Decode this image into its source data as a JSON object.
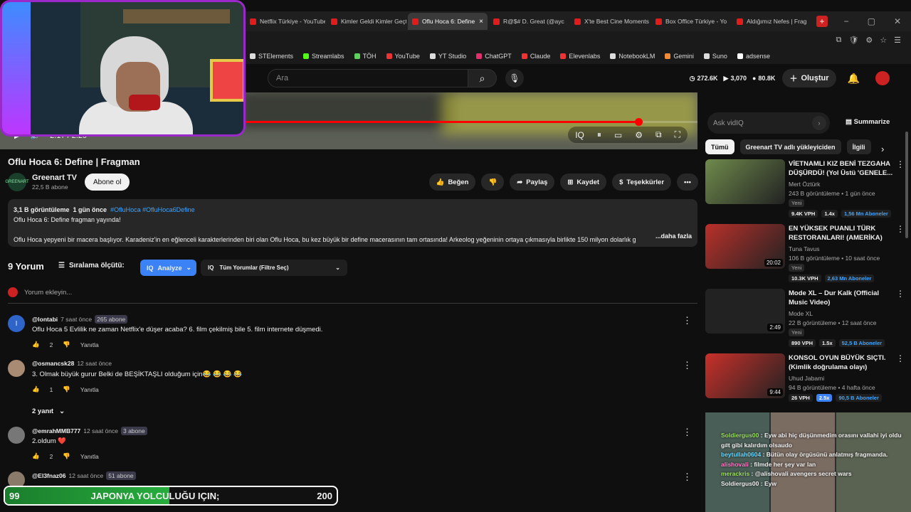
{
  "browser": {
    "tabs": [
      {
        "label": "Netflix Türkiye - YouTube",
        "active": false
      },
      {
        "label": "Kimler Geldi Kimler Geçti",
        "active": false
      },
      {
        "label": "Oflu Hoca 6: Define",
        "active": true
      },
      {
        "label": "R@$# D. Great (@ayc",
        "active": false
      },
      {
        "label": "X'te Best Cine Moments",
        "active": false
      },
      {
        "label": "Box Office Türkiye - Yo",
        "active": false
      },
      {
        "label": "Aldığımız Nefes | Frag",
        "active": false
      }
    ],
    "bookmarks": [
      "STElements",
      "Streamlabs",
      "TÖH",
      "YouTube",
      "YT Studio",
      "ChatGPT",
      "Claude",
      "Elevenlabs",
      "NotebookLM",
      "Gemini",
      "Suno",
      "adsense"
    ]
  },
  "header": {
    "search_placeholder": "Ara",
    "stats": [
      "272.6K",
      "3,070",
      "80.8K"
    ],
    "create_label": "Oluştur"
  },
  "player": {
    "time": "2:17 / 2:29",
    "progress": 0.915
  },
  "video": {
    "title": "Oflu Hoca 6: Define | Fragman",
    "channel_name": "Greenart TV",
    "channel_subs": "22,5 B abone",
    "channel_avatar_text": "GREENART",
    "subscribe_label": "Abone ol",
    "actions": {
      "like": "Beğen",
      "share": "Paylaş",
      "save": "Kaydet",
      "thanks": "Teşekkürler"
    }
  },
  "description": {
    "views": "3,1 B görüntüleme",
    "date": "1 gün önce",
    "tags": "#OfluHoca #OfluHoca6Define",
    "line1": "Oflu Hoca 6: Define fragman yayında!",
    "line2": "Oflu Hoca yepyeni bir macera başlıyor. Karadeniz'in en eğlenceli karakterlerinden biri olan Oflu Hoca, bu kez büyük bir define macerasının tam ortasında! Arkeolog yeğeninin ortaya çıkmasıyla birlikte 150 milyon dolarlık g",
    "more": "...daha fazla"
  },
  "comments_header": {
    "count": "9 Yorum",
    "sort_label": "Sıralama ölçütü:",
    "analyze_label": "Analyze",
    "filter_label": "Tüm Yorumlar (Filtre Seç)",
    "add_placeholder": "Yorum ekleyin..."
  },
  "comments": [
    {
      "user": "@lontabi",
      "time": "7 saat önce",
      "badge": "265 abone",
      "text": "Oflu Hoca 5 Evlilik ne zaman Netflix'e düşer acaba? 6. film çekilmiş bile 5. film internete düşmedi.",
      "likes": "2",
      "reply": "Yanıtla",
      "avatar": "I",
      "color": "#2f64c8"
    },
    {
      "user": "@osmancsk28",
      "time": "12 saat önce",
      "badge": "",
      "text": "3. Olmak büyük gurur Belki de BEŞİKTAŞLI olduğum için😂 😂 😂 😂",
      "likes": "1",
      "reply": "Yanıtla",
      "avatar": "",
      "color": "#a98b74"
    },
    {
      "user": "@emrahMMB777",
      "time": "12 saat önce",
      "badge": "3 abone",
      "text": "2.oldum ❤️",
      "likes": "2",
      "reply": "Yanıtla",
      "avatar": "",
      "color": "#777"
    },
    {
      "user": "@El3fnaz06",
      "time": "12 saat önce",
      "badge": "51 abone",
      "text": "",
      "likes": "",
      "reply": "",
      "avatar": "",
      "color": "#8a7a6a"
    }
  ],
  "replies_toggle": "2 yanıt",
  "sidebar": {
    "vidiq_placeholder": "Ask vidIQ",
    "summarize_label": "Summarize",
    "chips": [
      "Tümü",
      "Greenart TV adlı yükleyiciden",
      "İlgili"
    ],
    "recs": [
      {
        "title": "VİETNAMLI KIZ BENİ TEZGAHA DÜŞÜRDÜ! (Yol Üstü 'GENELE...",
        "channel": "Mert Öztürk",
        "views": "243 B görüntüleme • 1 gün önce",
        "new": "Yeni",
        "vph": "9.4K VPH",
        "mult": "1.4x",
        "subs": "1,56 Mn Aboneler",
        "duration": "",
        "color": "#6f8a4c"
      },
      {
        "title": "EN YÜKSEK PUANLI TÜRK RESTORANLARI! (AMERİKA)",
        "channel": "Tuna Tavus",
        "views": "106 B görüntüleme • 10 saat önce",
        "new": "Yeni",
        "vph": "10.3K VPH",
        "mult": "",
        "subs": "2,63 Mn Aboneler",
        "duration": "20:02",
        "color": "#b9302a"
      },
      {
        "title": "Mode XL – Dur Kalk (Official Music Video)",
        "channel": "Mode XL",
        "views": "22 B görüntüleme • 12 saat önce",
        "new": "Yeni",
        "vph": "890 VPH",
        "mult": "1.5x",
        "subs": "52,5 B Aboneler",
        "duration": "2:49",
        "color": "#222"
      },
      {
        "title": "KONSOL OYUN BÜYÜK SIÇTI. (Kimlik doğrulama olayı)",
        "channel": "Uhud Jabami",
        "views": "94 B görüntüleme • 4 hafta önce",
        "new": "",
        "vph": "26 VPH",
        "mult": "2.5x",
        "subs": "90,5 B Aboneler",
        "duration": "9:44",
        "color": "#c9302a"
      }
    ]
  },
  "chat": [
    {
      "user": "Soldiergus00",
      "msg": "Eyw abi hiç düşünmedim orasını vallahi iyi oldu g#t gibi kalırdım olsaudo"
    },
    {
      "user": "beytullah0604",
      "msg": "Bütün olay örgüsünü anlatmış fragmanda."
    },
    {
      "user": "alishovali",
      "msg": "filmde her şey var lan"
    },
    {
      "user": "merackris",
      "msg": "@alishovali avengers secret wars"
    },
    {
      "user": "Soldiergus00",
      "msg": "Eyw"
    }
  ],
  "overlay": {
    "current": "99",
    "goal_text": "JAPONYA YOLCULUĞU IÇIN;",
    "target": "200",
    "progress": 0.495
  }
}
